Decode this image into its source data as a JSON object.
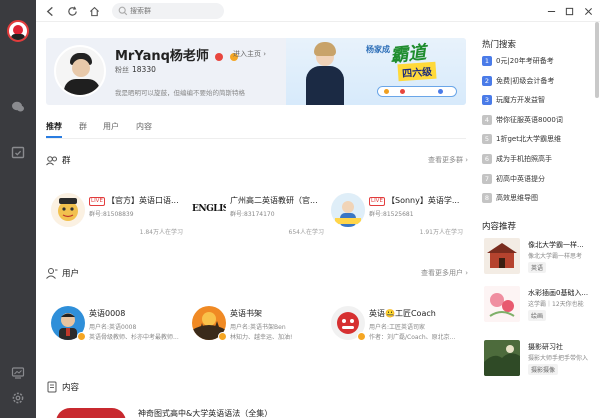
{
  "topbar": {
    "search_placeholder": "搜索群"
  },
  "profile": {
    "name": "MrYanq杨老师",
    "enter_home": "进入主页",
    "fans_label": "粉丝",
    "fans_count": "18330",
    "bio": "我是晒明可以旋鼓，但编编不要始的简斯特格",
    "banner": {
      "line1": "杨家成",
      "line2": "霸道",
      "line3": "四六级"
    }
  },
  "tabs": [
    {
      "label": "推荐",
      "active": true
    },
    {
      "label": "群",
      "active": false
    },
    {
      "label": "用户",
      "active": false
    },
    {
      "label": "内容",
      "active": false
    }
  ],
  "groups_section": {
    "title": "群",
    "more": "查看更多群",
    "items": [
      {
        "live": "LIVE",
        "title": "【官方】英语口语...",
        "id": "群号:81508839",
        "learning": "1.84万人在学习"
      },
      {
        "live": "",
        "title": "广州高二英语教研（官...",
        "id": "群号:83174170",
        "learning": "654人在学习",
        "logo_text": "ENGLISH"
      },
      {
        "live": "LIVE",
        "title": "【Sonny】英语学...",
        "id": "群号:81525681",
        "learning": "1.91万人在学习"
      }
    ]
  },
  "users_section": {
    "title": "用户",
    "more": "查看更多用户",
    "items": [
      {
        "name": "英语0008",
        "handle": "用户名:英语0008",
        "desc": "英语骨级教师、杉亦中考最教师..."
      },
      {
        "name": "英语书架",
        "handle": "用户名:英语书架Ben",
        "desc": "林知力、越幸运、加油!"
      },
      {
        "name": "英语🤐工匠Coach",
        "handle": "用户名:工匠英语司家",
        "desc": "作者：刘广磊/Coach、原北京..."
      }
    ]
  },
  "content_section": {
    "title": "内容",
    "first_title": "神奇图式高中&大学英语语法（全集）"
  },
  "right": {
    "hot_title": "热门搜索",
    "hot": [
      {
        "num": "1",
        "text": "0元|20年考研备考",
        "color": "#4a7be8"
      },
      {
        "num": "2",
        "text": "免费|初级会计备考",
        "color": "#4a7be8"
      },
      {
        "num": "3",
        "text": "玩魔方开发益智",
        "color": "#4a7be8"
      },
      {
        "num": "4",
        "text": "带你征服英语8000词",
        "color": "#c4c4c4"
      },
      {
        "num": "5",
        "text": "1折get北大学霸思维",
        "color": "#c4c4c4"
      },
      {
        "num": "6",
        "text": "成为手机拍照高手",
        "color": "#c4c4c4"
      },
      {
        "num": "7",
        "text": "初高中英语提分",
        "color": "#c4c4c4"
      },
      {
        "num": "8",
        "text": "高效思维导图",
        "color": "#c4c4c4"
      }
    ],
    "rec_title": "内容推荐",
    "rec": [
      {
        "title": "像北大学霸一样...",
        "sub": "像北大学霸一样思考",
        "tag": "英语"
      },
      {
        "title": "水彩插画0基础入...",
        "sub": "这学霸｜12天你也能",
        "tag": "绘画"
      },
      {
        "title": "摄影研习社",
        "sub": "摄影大师手把手带你入",
        "tag": "摄影摄像"
      }
    ]
  },
  "colors": {
    "sidebar": "#3a3b3f",
    "accent": "#2a7de1",
    "live": "#e23c3c"
  }
}
